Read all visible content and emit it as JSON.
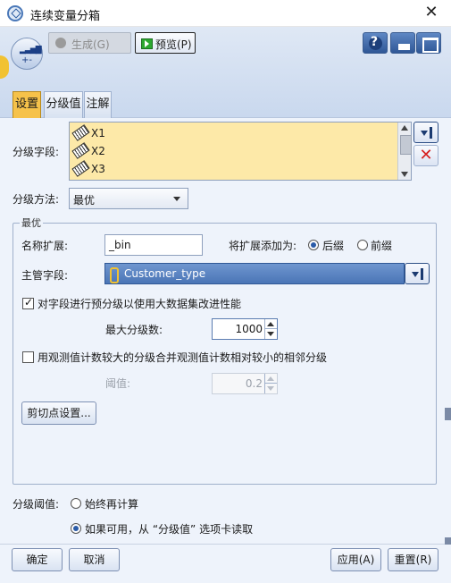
{
  "window": {
    "title": "连续变量分箱",
    "close_glyph": "✕"
  },
  "toolbar": {
    "generate_label": "生成(G)",
    "preview_label": "预览(P)",
    "help_icon": "help-icon",
    "minimize_icon": "minimize-icon",
    "maximize_icon": "maximize-icon"
  },
  "tabs": [
    {
      "label": "设置",
      "active": true
    },
    {
      "label": "分级值",
      "active": false
    },
    {
      "label": "注解",
      "active": false
    }
  ],
  "settings": {
    "bin_fields_label": "分级字段:",
    "bin_fields": [
      "X1",
      "X2",
      "X3"
    ],
    "bin_method_label": "分级方法:",
    "bin_method_value": "最优",
    "optimal_group_title": "最优",
    "name_ext_label": "名称扩展:",
    "name_ext_value": "_bin",
    "add_ext_label": "将扩展添加为:",
    "suffix_label": "后缀",
    "prefix_label": "前缀",
    "suffix_selected": true,
    "supervisor_label": "主管字段:",
    "supervisor_value": "Customer_type",
    "prebin_label": "对字段进行预分级以使用大数据集改进性能",
    "prebin_checked": true,
    "max_bins_label": "最大分级数:",
    "max_bins_value": "1000",
    "merge_label": "用观测值计数较大的分级合并观测值计数相对较小的相邻分级",
    "merge_checked": false,
    "threshold_label": "阈值:",
    "threshold_value": "0.2",
    "cutpoint_button": "剪切点设置...",
    "bin_thresholds_label": "分级阈值:",
    "always_recompute_label": "始终再计算",
    "read_from_tab_label": "如果可用，从 “分级值” 选项卡读取",
    "read_from_tab_selected": true
  },
  "footer": {
    "ok": "确定",
    "cancel": "取消",
    "apply": "应用(A)",
    "reset": "重置(R)"
  },
  "colors": {
    "active_tab": "#f6c24a",
    "field_list_bg": "#fde9a8",
    "supervisor_bg": "#5b85c2",
    "delete_icon": "#d61f1f"
  }
}
